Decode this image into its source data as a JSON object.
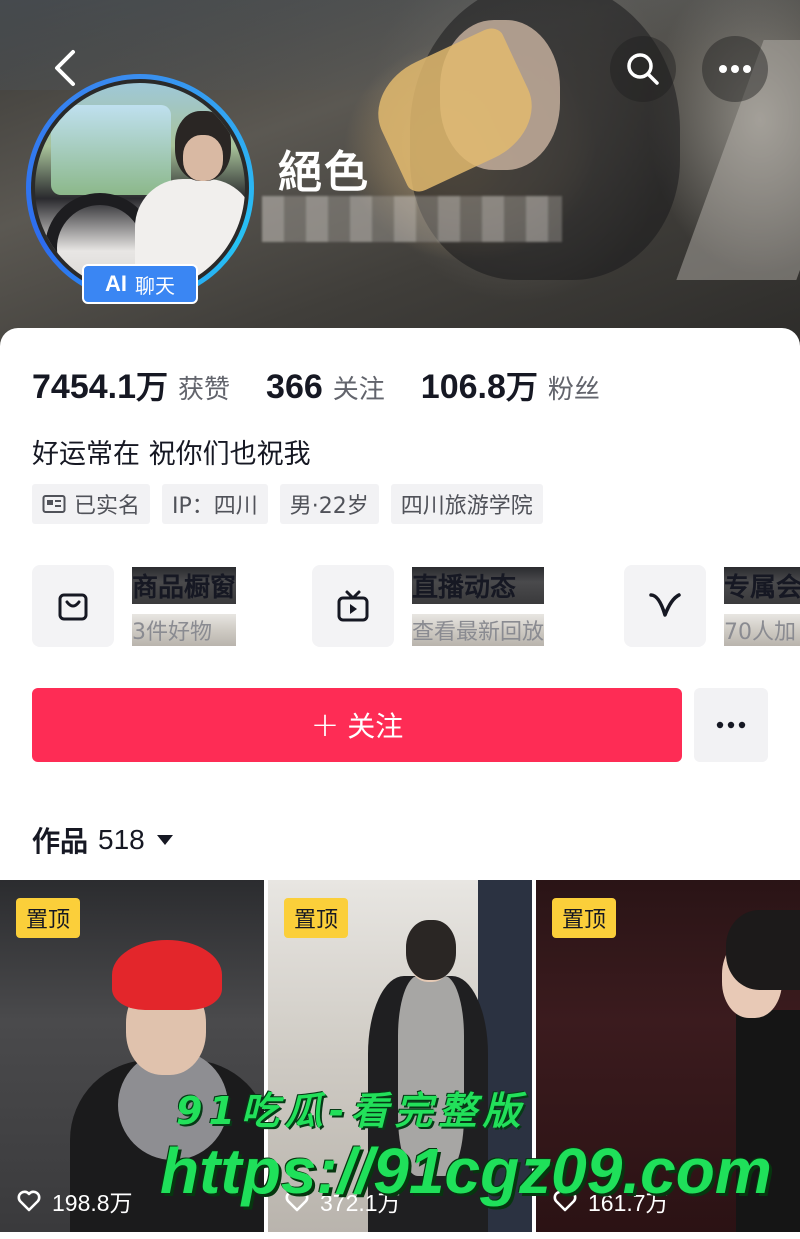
{
  "header": {
    "nickname": "絕色",
    "ai_badge": {
      "ai": "AI",
      "label": "聊天"
    }
  },
  "stats": [
    {
      "num": "7454.1",
      "unit": "万",
      "label": "获赞"
    },
    {
      "num": "366",
      "unit": "",
      "label": "关注"
    },
    {
      "num": "106.8",
      "unit": "万",
      "label": "粉丝"
    }
  ],
  "bio": "好运常在 祝你们也祝我",
  "tags": [
    {
      "label": "已实名",
      "icon": "id-card-icon"
    },
    {
      "label": "IP：四川"
    },
    {
      "label": "男·22岁"
    },
    {
      "label": "四川旅游学院"
    }
  ],
  "shortcuts": [
    {
      "title": "商品橱窗",
      "subtitle": "3件好物",
      "icon": "shopping-bag-icon"
    },
    {
      "title": "直播动态",
      "subtitle": "查看最新回放",
      "icon": "tv-play-icon"
    },
    {
      "title": "专属会",
      "subtitle": "70人加",
      "icon": "v-badge-icon"
    }
  ],
  "follow_button": {
    "label": "关注",
    "plus": "+"
  },
  "works": {
    "label": "作品",
    "count": "518"
  },
  "videos": [
    {
      "pinned": "置顶",
      "likes": "198.8万"
    },
    {
      "pinned": "置顶",
      "likes": "372.1万"
    },
    {
      "pinned": "置顶",
      "likes": "161.7万"
    }
  ],
  "watermark": {
    "line1": "91吃瓜-看完整版",
    "line2": "https://91cgz09.com"
  },
  "colors": {
    "accent": "#fe2c55",
    "pin_badge": "#fbcf3a",
    "ai_badge": "#3a86f3",
    "watermark": "#22e05a"
  }
}
